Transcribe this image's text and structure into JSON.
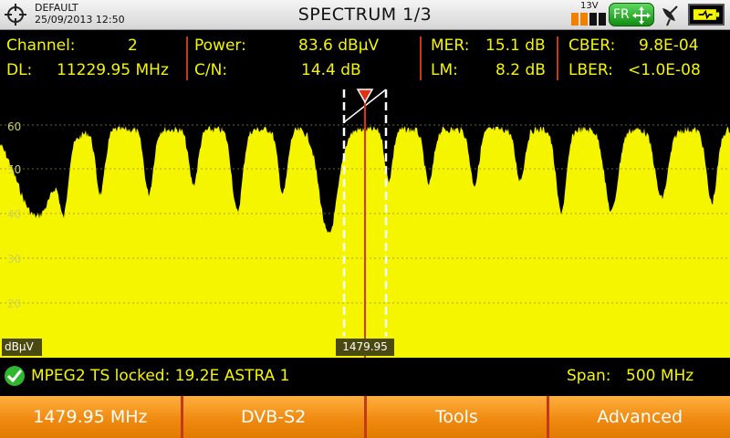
{
  "header": {
    "profile_name": "DEFAULT",
    "datetime": "25/09/2013 12:50",
    "title": "SPECTRUM 1/3",
    "lnb_voltage": "13V",
    "band_badge": "FR",
    "colors": {
      "badge": "#1a9a1a",
      "battery": "#f08000"
    }
  },
  "measurements": {
    "channel_label": "Channel:",
    "channel_value": "2",
    "dl_label": "DL:",
    "dl_value": "11229.95 MHz",
    "power_label": "Power:",
    "power_value": "83.6 dBµV",
    "cn_label": "C/N:",
    "cn_value": "14.4 dB",
    "mer_label": "MER:",
    "mer_value": "15.1 dB",
    "lm_label": "LM:",
    "lm_value": "8.2 dB",
    "cber_label": "CBER:",
    "cber_value": "9.8E-04",
    "lber_label": "LBER:",
    "lber_value": "<1.0E-08"
  },
  "spectrum": {
    "unit": "dBµV",
    "marker_frequency": "1479.95",
    "y_ticks": [
      "60",
      "50",
      "40",
      "30",
      "20"
    ],
    "colors": {
      "fill": "#f5f500",
      "background": "#000000",
      "marker": "#e03010"
    }
  },
  "status": {
    "lock_message": "MPEG2 TS locked: 19.2E ASTRA 1",
    "span_label": "Span:",
    "span_value": "500 MHz"
  },
  "softkeys": [
    {
      "label": "1479.95 MHz"
    },
    {
      "label": "DVB-S2"
    },
    {
      "label": "Tools"
    },
    {
      "label": "Advanced"
    }
  ]
}
